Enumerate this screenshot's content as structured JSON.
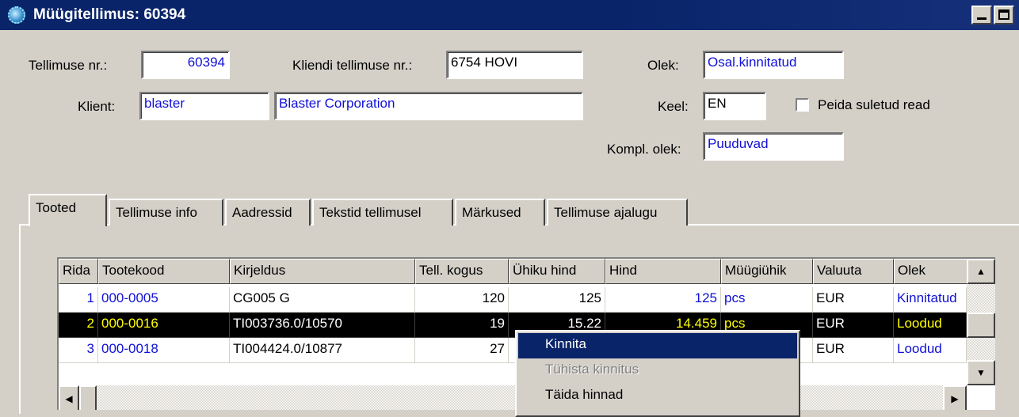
{
  "window": {
    "title": "Müügitellimus: 60394"
  },
  "form": {
    "order_no_label": "Tellimuse nr.:",
    "order_no": "60394",
    "client_order_label": "Kliendi tellimuse nr.:",
    "client_order_no": "6754 HOVI",
    "status_label": "Olek:",
    "status": "Osal.kinnitatud",
    "client_label": "Klient:",
    "client_code": "blaster",
    "client_name": "Blaster Corporation",
    "lang_label": "Keel:",
    "lang": "EN",
    "hide_closed_label": "Peida suletud read",
    "hide_closed_checked": false,
    "set_status_label": "Kompl. olek:",
    "set_status": "Puuduvad"
  },
  "tabs": [
    {
      "label": "Tooted",
      "active": true
    },
    {
      "label": "Tellimuse info"
    },
    {
      "label": "Aadressid"
    },
    {
      "label": "Tekstid tellimusel"
    },
    {
      "label": "Märkused"
    },
    {
      "label": "Tellimuse ajalugu"
    }
  ],
  "grid": {
    "columns": [
      "Rida",
      "Tootekood",
      "Kirjeldus",
      "Tell. kogus",
      "Ühiku hind",
      "Hind",
      "Müügiühik",
      "Valuuta",
      "Olek"
    ],
    "rows": [
      {
        "rida": "1",
        "code": "000-0005",
        "desc": "CG005 G",
        "qty": "120",
        "unit_price": "125",
        "price": "125",
        "unit": "pcs",
        "currency": "EUR",
        "status": "Kinnitatud",
        "selected": false
      },
      {
        "rida": "2",
        "code": "000-0016",
        "desc": "TI003736.0/10570",
        "qty": "19",
        "unit_price": "15.22",
        "price": "14.459",
        "unit": "pcs",
        "currency": "EUR",
        "status": "Loodud",
        "selected": true
      },
      {
        "rida": "3",
        "code": "000-0018",
        "desc": "TI004424.0/10877",
        "qty": "27",
        "unit_price": "",
        "price": "",
        "unit": "",
        "currency": "EUR",
        "status": "Loodud",
        "selected": false
      }
    ]
  },
  "context_menu": {
    "items": [
      {
        "label": "Kinnita",
        "highlighted": true
      },
      {
        "label": "Tühista kinnitus",
        "disabled": true
      },
      {
        "label": "Täida hinnad"
      }
    ]
  },
  "colors": {
    "titlebar": "#0a246a",
    "value_text": "#1010d8",
    "selection": "#000000",
    "selected_text_accent": "#ffff00"
  }
}
